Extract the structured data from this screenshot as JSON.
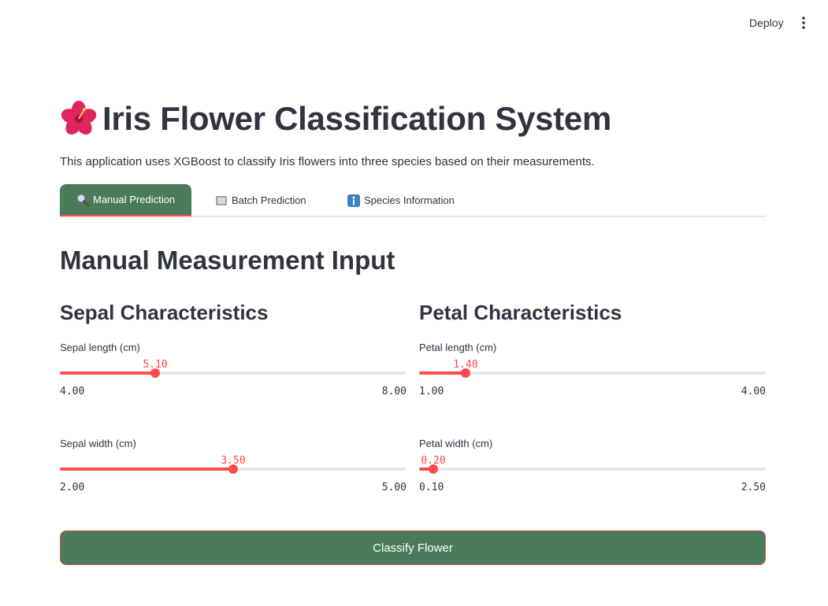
{
  "topbar": {
    "deploy_label": "Deploy",
    "menu_icon": "more-vertical-icon"
  },
  "header": {
    "icon": "hibiscus-icon",
    "title": "Iris Flower Classification System",
    "description": "This application uses XGBoost to classify Iris flowers into three species based on their measurements."
  },
  "tabs": [
    {
      "label": "Manual Prediction",
      "icon": "magnifier-icon",
      "active": true
    },
    {
      "label": "Batch Prediction",
      "icon": "folder-icon",
      "active": false
    },
    {
      "label": "Species Information",
      "icon": "info-icon",
      "active": false
    }
  ],
  "main": {
    "section_title": "Manual Measurement Input",
    "sepal": {
      "title": "Sepal Characteristics",
      "length": {
        "label": "Sepal length (cm)",
        "value": "5.10",
        "min": "4.00",
        "max": "8.00",
        "fraction": 0.275
      },
      "width": {
        "label": "Sepal width (cm)",
        "value": "3.50",
        "min": "2.00",
        "max": "5.00",
        "fraction": 0.5
      }
    },
    "petal": {
      "title": "Petal Characteristics",
      "length": {
        "label": "Petal length (cm)",
        "value": "1.40",
        "min": "1.00",
        "max": "4.00",
        "fraction": 0.133
      },
      "width": {
        "label": "Petal width (cm)",
        "value": "0.20",
        "min": "0.10",
        "max": "2.50",
        "fraction": 0.042
      }
    },
    "classify_label": "Classify Flower"
  },
  "colors": {
    "accent": "#ff4b4b",
    "primary_green": "#4a7c59",
    "text": "#31333f",
    "track": "#e6e8ee"
  }
}
